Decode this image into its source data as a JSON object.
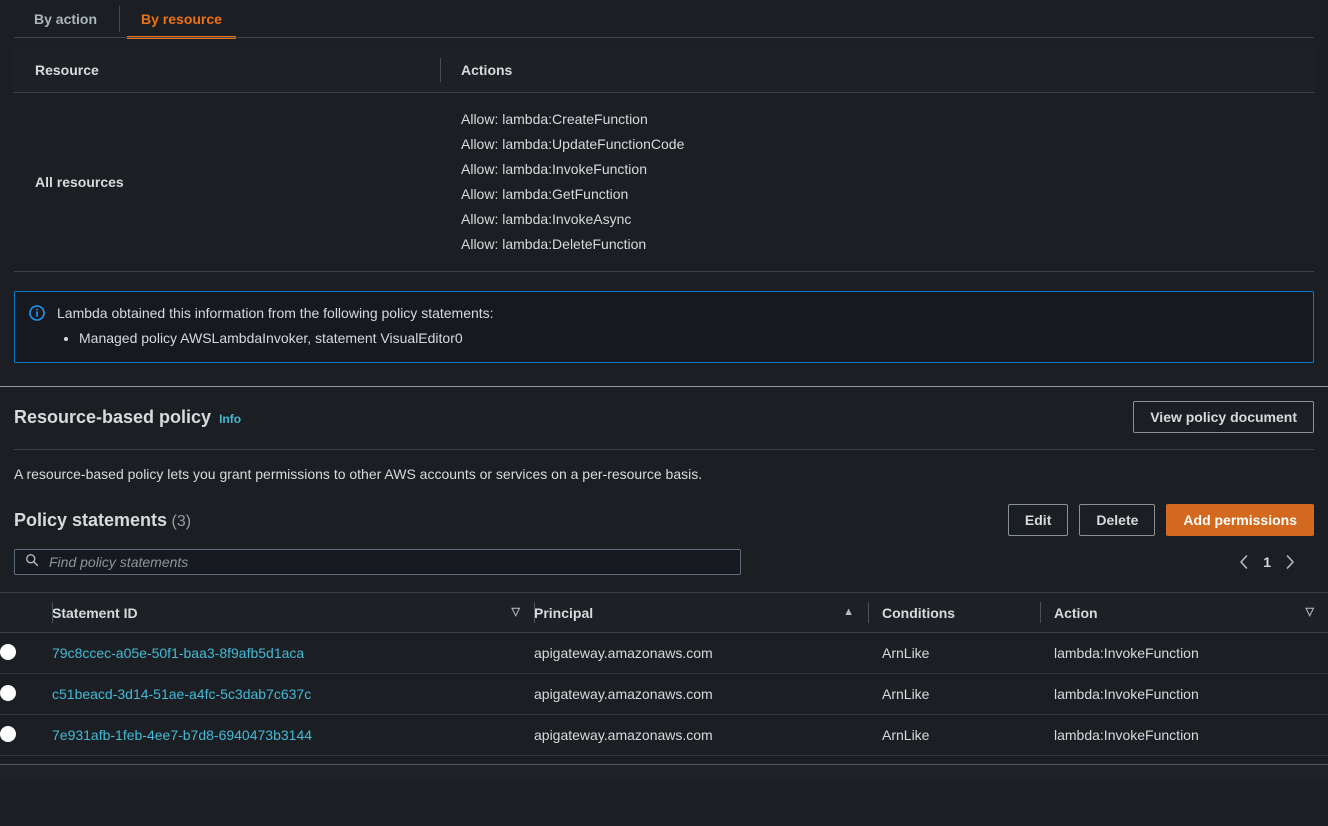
{
  "tabs": [
    {
      "label": "By action",
      "active": false
    },
    {
      "label": "By resource",
      "active": true
    }
  ],
  "resource_table": {
    "headers": {
      "resource": "Resource",
      "actions": "Actions"
    },
    "rows": [
      {
        "resource": "All resources",
        "actions": [
          "Allow: lambda:CreateFunction",
          "Allow: lambda:UpdateFunctionCode",
          "Allow: lambda:InvokeFunction",
          "Allow: lambda:GetFunction",
          "Allow: lambda:InvokeAsync",
          "Allow: lambda:DeleteFunction"
        ]
      }
    ]
  },
  "alert": {
    "icon": "info-icon",
    "title": "Lambda obtained this information from the following policy statements:",
    "items": [
      "Managed policy AWSLambdaInvoker, statement VisualEditor0"
    ],
    "border_color": "#0a7ac4"
  },
  "resource_policy": {
    "title": "Resource-based policy",
    "info_label": "Info",
    "view_button": "View policy document",
    "description": "A resource-based policy lets you grant permissions to other AWS accounts or services on a per-resource basis."
  },
  "policy_statements": {
    "title": "Policy statements",
    "count": "(3)",
    "buttons": {
      "edit": "Edit",
      "delete": "Delete",
      "add": "Add permissions"
    },
    "search": {
      "placeholder": "Find policy statements",
      "icon": "search-icon"
    },
    "pagination": {
      "prev": "‹",
      "page": "1",
      "next": "›"
    },
    "columns": [
      {
        "label": "Statement ID",
        "sort": "descending"
      },
      {
        "label": "Principal",
        "sort": "ascending"
      },
      {
        "label": "Conditions",
        "sort": "none"
      },
      {
        "label": "Action",
        "sort": "descending"
      }
    ],
    "rows": [
      {
        "statement_id": "79c8ccec-a05e-50f1-baa3-8f9afb5d1aca",
        "principal": "apigateway.amazonaws.com",
        "conditions": "ArnLike",
        "action": "lambda:InvokeFunction"
      },
      {
        "statement_id": "c51beacd-3d14-51ae-a4fc-5c3dab7c637c",
        "principal": "apigateway.amazonaws.com",
        "conditions": "ArnLike",
        "action": "lambda:InvokeFunction"
      },
      {
        "statement_id": "7e931afb-1feb-4ee7-b7d8-6940473b3144",
        "principal": "apigateway.amazonaws.com",
        "conditions": "ArnLike",
        "action": "lambda:InvokeFunction"
      }
    ]
  },
  "colors": {
    "accent_orange": "#ec7211",
    "primary_button": "#d2691e",
    "link_blue": "#44b9d6",
    "info_border": "#0a7ac4",
    "background": "#1b1f23"
  }
}
